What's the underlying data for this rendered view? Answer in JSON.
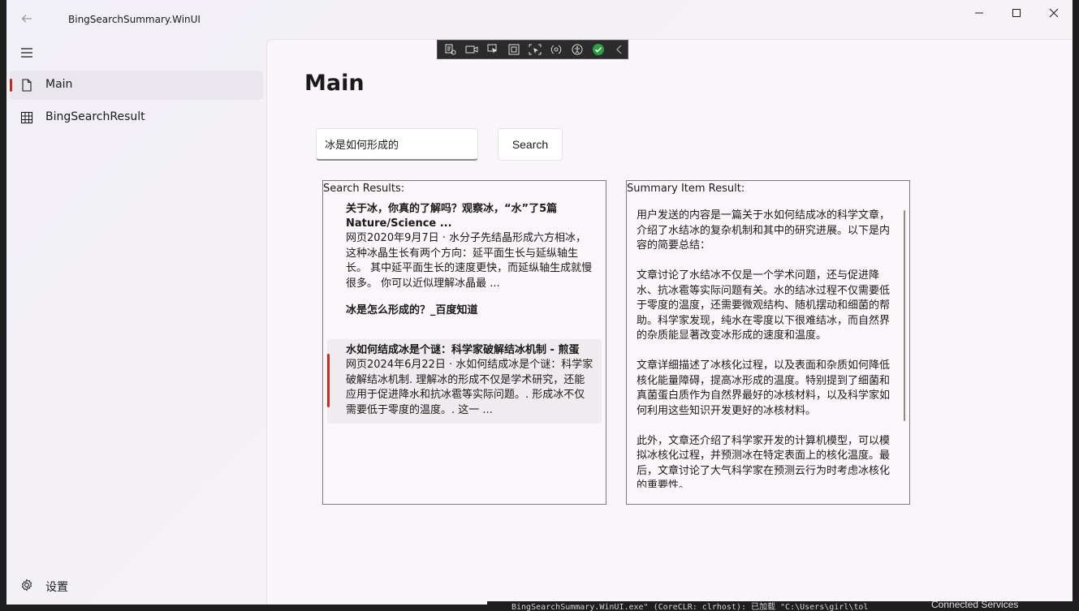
{
  "window": {
    "title": "BingSearchSummary.WinUI"
  },
  "nav": {
    "items": [
      {
        "label": "Main",
        "icon": "page-icon",
        "selected": true
      },
      {
        "label": "BingSearchResult",
        "icon": "grid-icon",
        "selected": false
      }
    ],
    "settings_label": "设置"
  },
  "page": {
    "title": "Main"
  },
  "search": {
    "value": "冰是如何形成的",
    "button_label": "Search"
  },
  "results": {
    "heading": "Search Results:",
    "items": [
      {
        "title": "关于冰，你真的了解吗？观察冰，“水”了5篇 Nature/Science ...",
        "snippet": "网页2020年9月7日 · 水分子先结晶形成六方相冰，这种冰晶生长有两个方向：延平面生长与延纵轴生长。 其中延平面生长的速度更快，而延纵轴生成就慢很多。 你可以近似理解冰晶最 ..."
      },
      {
        "title": "冰是怎么形成的？_百度知道",
        "snippet": ""
      },
      {
        "title": "水如何结成冰是个谜：科学家破解结冰机制 - 煎蛋",
        "snippet": "网页2024年6月22日 · 水如何结成冰是个谜：科学家破解结冰机制. 理解冰的形成不仅是学术研究，还能应用于促进降水和抗冰雹等实际问题。. 形成冰不仅需要低于零度的温度。. 这一 ..."
      }
    ],
    "selected_index": 2
  },
  "summary": {
    "heading": "Summary Item Result:",
    "paragraphs": [
      "用户发送的内容是一篇关于水如何结成冰的科学文章，介绍了水结冰的复杂机制和其中的研究进展。以下是内容的简要总结：",
      "文章讨论了水结冰不仅是一个学术问题，还与促进降水、抗冰雹等实际问题有关。水的结冰过程不仅需要低于零度的温度，还需要微观结构、随机摆动和细菌的帮助。科学家发现，纯水在零度以下很难结冰，而自然界的杂质能显著改变冰形成的速度和温度。",
      "文章详细描述了冰核化过程，以及表面和杂质如何降低核化能量障碍，提高冰形成的温度。特别提到了细菌和真菌蛋白质作为自然界最好的冰核材料，以及科学家如何利用这些知识开发更好的冰核材料。",
      "此外，文章还介绍了科学家开发的计算机模型，可以模拟冰核化过程，并预测冰在特定表面上的核化温度。最后，文章讨论了大气科学家在预测云行为时考虑冰核化的重要性。"
    ]
  },
  "background": {
    "status_text": "BingSearchSummary.WinUI.exe\" (CoreCLR: clrhost): 已加载 \"C:\\Users\\girl\\tol",
    "connected_services": "Connected Services"
  },
  "colors": {
    "accent": "#c42b1c",
    "debug_check": "#2ea043"
  }
}
